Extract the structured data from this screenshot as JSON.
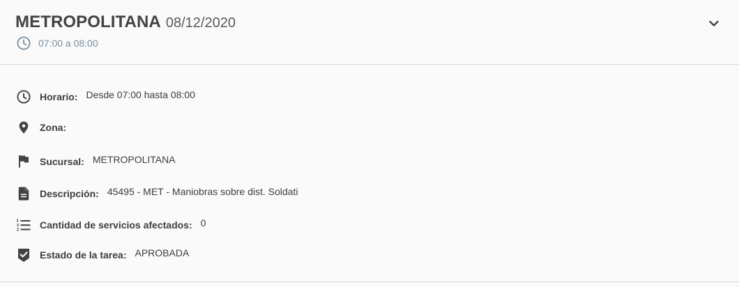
{
  "header": {
    "title": "METROPOLITANA",
    "date": "08/12/2020",
    "time_range": "07:00 a 08:00",
    "time_icon": "clock-icon",
    "toggle_icon": "chevron-down-icon"
  },
  "details": [
    {
      "icon": "clock-icon",
      "label": "Horario:",
      "value": "Desde 07:00 hasta 08:00"
    },
    {
      "icon": "location-pin-icon",
      "label": "Zona:",
      "value": ""
    },
    {
      "icon": "flag-icon",
      "label": "Sucursal:",
      "value": "METROPOLITANA"
    },
    {
      "icon": "document-icon",
      "label": "Descripción:",
      "value": "45495 - MET - Maniobras sobre dist. Soldati"
    },
    {
      "icon": "list-numbered-icon",
      "label": "Cantidad de servicios afectados:",
      "value": "0"
    },
    {
      "icon": "shield-check-icon",
      "label": "Estado de la tarea:",
      "value": "APROBADA"
    }
  ],
  "colors": {
    "text": "#424242",
    "subtle": "#7a8fa0",
    "divider": "#d6d6d6",
    "background": "#fafafa"
  }
}
